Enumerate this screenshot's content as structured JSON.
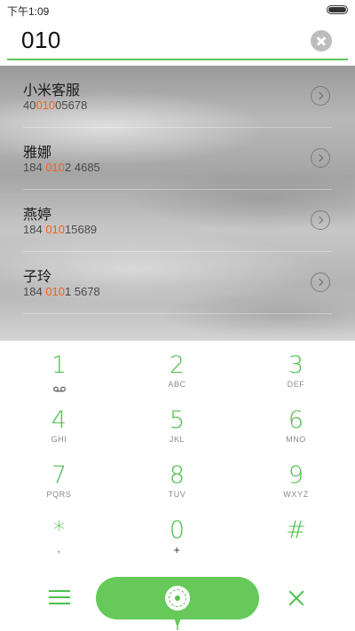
{
  "status_bar": {
    "time": "下午1:09",
    "battery_level": 1.0
  },
  "search": {
    "value": "010"
  },
  "contacts": [
    {
      "name": "小米客服",
      "number_pre": "40",
      "number_match": "010",
      "number_post": "05678"
    },
    {
      "name": "雅娜",
      "number_pre": "184 ",
      "number_match": "010",
      "number_post": "2 4685"
    },
    {
      "name": "燕婷",
      "number_pre": "184 ",
      "number_match": "010",
      "number_post": "15689"
    },
    {
      "name": "子玲",
      "number_pre": "184 ",
      "number_match": "010",
      "number_post": "1 5678"
    }
  ],
  "dialpad": {
    "keys": [
      {
        "digit": "1",
        "sub": ""
      },
      {
        "digit": "2",
        "sub": "ABC"
      },
      {
        "digit": "3",
        "sub": "DEF"
      },
      {
        "digit": "4",
        "sub": "GHI"
      },
      {
        "digit": "5",
        "sub": "JKL"
      },
      {
        "digit": "6",
        "sub": "MNO"
      },
      {
        "digit": "7",
        "sub": "PQRS"
      },
      {
        "digit": "8",
        "sub": "TUV"
      },
      {
        "digit": "9",
        "sub": "WXYZ"
      },
      {
        "digit": "*",
        "sub": ","
      },
      {
        "digit": "0",
        "sub": "+"
      },
      {
        "digit": "#",
        "sub": ""
      }
    ]
  },
  "colors": {
    "accent": "#4cbf4c",
    "call_button": "#66c95a",
    "match_highlight": "#f0631e"
  },
  "icons": {
    "voicemail": "voicemail-icon",
    "clear": "clear-icon",
    "chevron": "chevron-right-icon",
    "menu": "menu-icon",
    "call": "call-icon",
    "delete": "delete-icon"
  }
}
